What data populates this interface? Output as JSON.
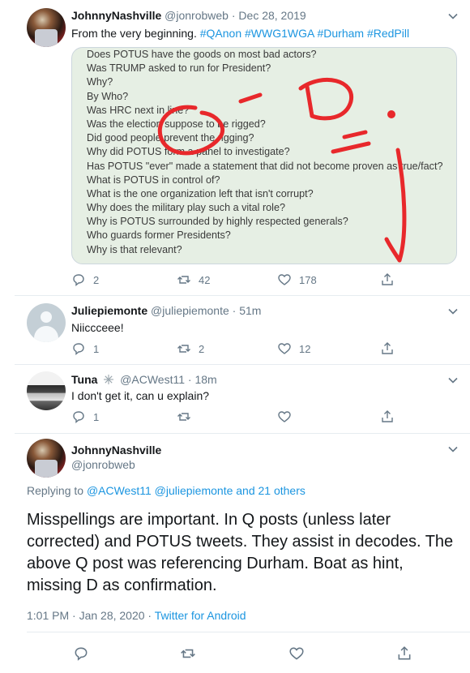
{
  "tweet1": {
    "name": "JohnnyNashville",
    "handle": "@jonrobweb",
    "sep": "·",
    "date": "Dec 28, 2019",
    "text_plain": "From the very beginning. ",
    "hashtags": [
      "#QAnon",
      "#WWG1WGA",
      "#Durham",
      "#RedPill"
    ],
    "image_lines": [
      "Does POTUS have the goods on most bad actors?",
      "Was TRUMP asked to run for President?",
      "Why?",
      "By Who?",
      "Was HRC next in line?",
      "Was the election suppose to be rigged?",
      "Did good people prevent the rigging?",
      "Why did POTUS form a panel to investigate?",
      "Has POTUS \"ever\" made a statement that did not become proven as true/fact?",
      "What is POTUS in control of?",
      "What is the one organization left that isn't corrupt?",
      "Why does the military play such a vital role?",
      "Why is POTUS surrounded by highly respected generals?",
      "Who guards former Presidents?",
      "Why is that relevant?"
    ],
    "replies": "2",
    "retweets": "42",
    "likes": "178"
  },
  "tweet2": {
    "name": "Juliepiemonte",
    "handle": "@juliepiemonte",
    "sep": "·",
    "date": "51m",
    "text": "Niiccceee!",
    "replies": "1",
    "retweets": "2",
    "likes": "12"
  },
  "tweet3": {
    "name": "Tuna",
    "handle": "@ACWest11",
    "sep": "·",
    "date": "18m",
    "text": "I don't get it, can u explain?",
    "replies": "1"
  },
  "tweet4": {
    "name": "JohnnyNashville",
    "handle": "@jonrobweb",
    "replying_prefix": "Replying to ",
    "replying_to": "@ACWest11 @juliepiemonte and 21 others",
    "text": "Misspellings are important. In Q posts (unless later corrected) and POTUS tweets. They assist in decodes. The above Q post was referencing Durham. Boat as hint, missing D as confirmation.",
    "time": "1:01 PM · Jan 28, 2020 · ",
    "source": "Twitter for Android"
  },
  "colors": {
    "link": "#1b95e0",
    "muted": "#657786",
    "marker": "#e8282b"
  }
}
